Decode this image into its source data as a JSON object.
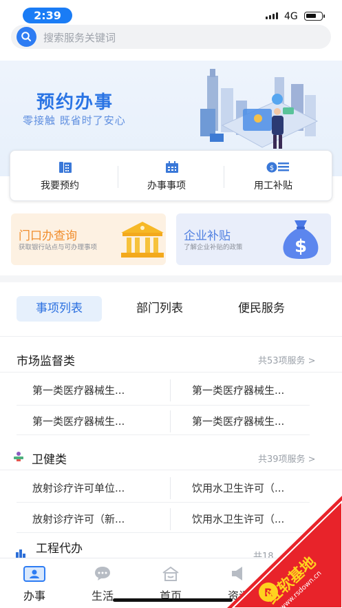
{
  "status": {
    "time": "2:39",
    "network": "4G"
  },
  "search": {
    "placeholder": "搜索服务关键词"
  },
  "banner": {
    "title": "预约办事",
    "subtitle": "零接触   既省时了安心"
  },
  "quick_actions": [
    {
      "label": "我要预约",
      "icon": "phone-book-icon"
    },
    {
      "label": "办事事项",
      "icon": "calendar-icon"
    },
    {
      "label": "用工补贴",
      "icon": "money-list-icon"
    }
  ],
  "promos": [
    {
      "title": "门口办查询",
      "subtitle": "获取银行站点与可办理事项",
      "icon": "bank-icon"
    },
    {
      "title": "企业补贴",
      "subtitle": "了解企业补贴的政策",
      "icon": "money-bag-icon"
    }
  ],
  "tabs": [
    {
      "label": "事项列表",
      "active": true
    },
    {
      "label": "部门列表",
      "active": false
    },
    {
      "label": "便民服务",
      "active": false
    }
  ],
  "sections": [
    {
      "title": "市场监督类",
      "count": "共53项服务 >",
      "items": [
        "第一类医疗器械生...",
        "第一类医疗器械生...",
        "第一类医疗器械生...",
        "第一类医疗器械生..."
      ]
    },
    {
      "title": "卫健类",
      "count": "共39项服务 >",
      "items": [
        "放射诊疗许可单位...",
        "饮用水卫生许可（...",
        "放射诊疗许可（新...",
        "饮用水卫生许可（..."
      ]
    },
    {
      "title": "工程代办",
      "count": "共18"
    }
  ],
  "tabbar": [
    {
      "label": "办事",
      "icon": "id-card-icon",
      "active": true
    },
    {
      "label": "生活",
      "icon": "chat-icon",
      "active": false
    },
    {
      "label": "首页",
      "icon": "home-icon",
      "active": false
    },
    {
      "label": "资讯",
      "icon": "speaker-icon",
      "active": false
    }
  ],
  "watermark": {
    "brand": "红软基地",
    "url": "www.rsdown.cn"
  },
  "colors": {
    "accent": "#2a6fe0",
    "orange": "#f08c2b",
    "watermark_red": "#e8232a",
    "watermark_yellow": "#ffd21f"
  }
}
